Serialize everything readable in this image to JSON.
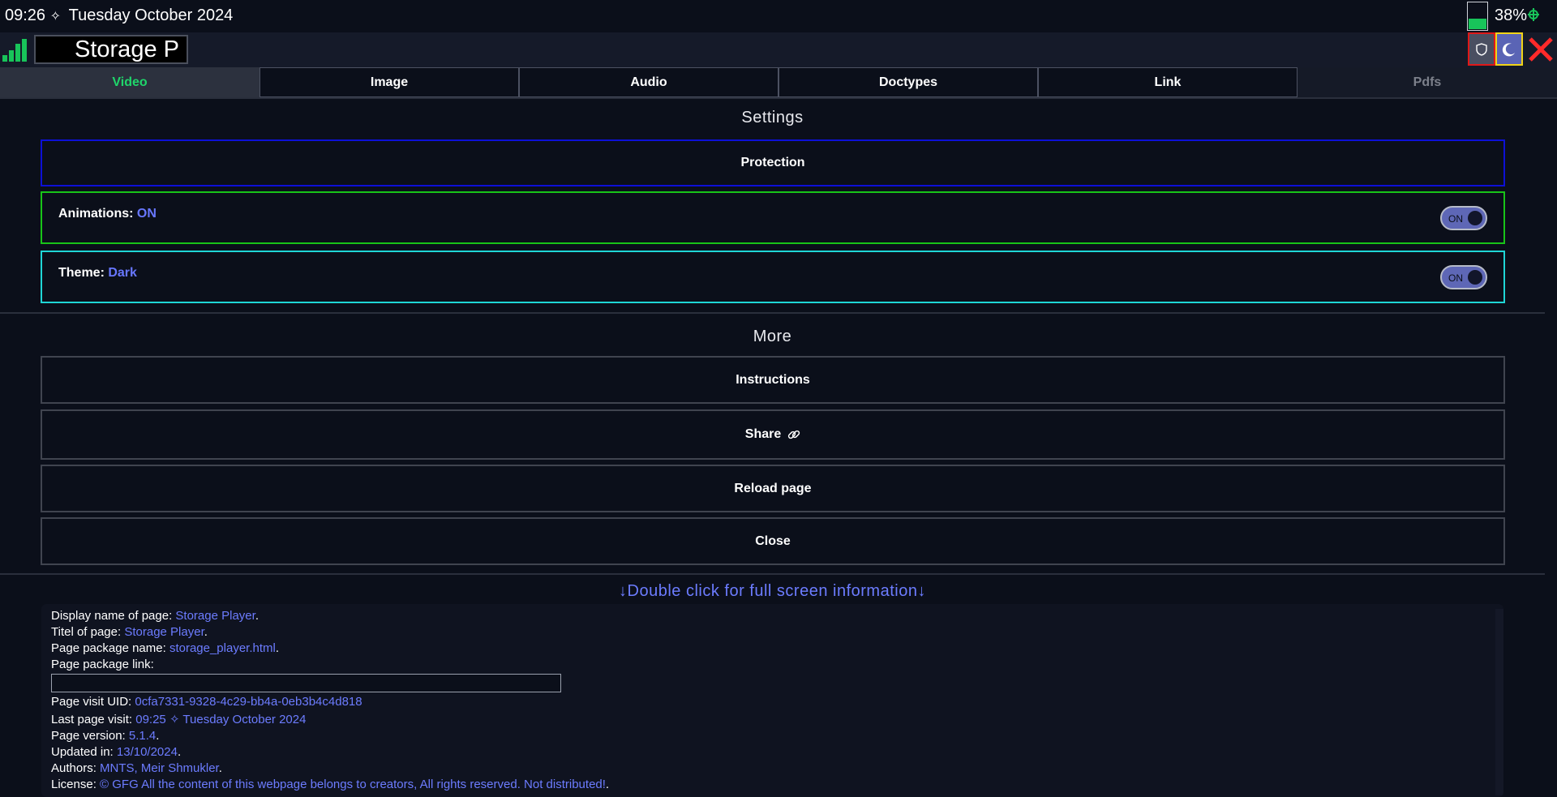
{
  "status_bar": {
    "time": "09:26",
    "separator": "✧",
    "date": "Tuesday October 2024",
    "battery_level": 0.38,
    "battery_percent": "38%",
    "charging_icon": "plug-icon"
  },
  "header": {
    "title": "Storage P",
    "signal_icon": "signal-bars-icon",
    "buttons": {
      "protection_icon": "shield-icon",
      "theme_icon": "moon-icon",
      "close_icon": "close-icon"
    }
  },
  "tabs": [
    {
      "label": "Video",
      "state": "active"
    },
    {
      "label": "Image",
      "state": "normal"
    },
    {
      "label": "Audio",
      "state": "normal"
    },
    {
      "label": "Doctypes",
      "state": "normal"
    },
    {
      "label": "Link",
      "state": "normal"
    },
    {
      "label": "Pdfs",
      "state": "disabled"
    }
  ],
  "settings": {
    "title": "Settings",
    "protection_label": "Protection",
    "animations": {
      "label": "Animations: ",
      "value": "ON",
      "toggle": "ON"
    },
    "theme": {
      "label": "Theme: ",
      "value": "Dark",
      "toggle": "ON"
    }
  },
  "more": {
    "title": "More",
    "instructions_label": "Instructions",
    "share_label": "Share",
    "share_icon": "link-icon",
    "reload_label": "Reload page",
    "close_label": "Close"
  },
  "info": {
    "hint": "↓Double click for full screen information↓",
    "rows": {
      "display_name": {
        "label": "Display name of page: ",
        "value": "Storage Player",
        "end": "."
      },
      "title": {
        "label": "Titel of page: ",
        "value": "Storage Player",
        "end": "."
      },
      "package_name": {
        "label": "Page package name: ",
        "value": "storage_player.html",
        "end": "."
      },
      "package_link": {
        "label": "Page package link:"
      },
      "visit_uid": {
        "label": "Page visit UID: ",
        "value": "0cfa7331-9328-4c29-bb4a-0eb3b4c4d818"
      },
      "last_visit": {
        "label": "Last page visit: ",
        "value": "09:25 ✧ Tuesday October 2024"
      },
      "version": {
        "label": "Page version: ",
        "value": "5.1.4",
        "end": "."
      },
      "updated": {
        "label": "Updated in: ",
        "value": "13/10/2024",
        "end": "."
      },
      "authors": {
        "label": "Authors: ",
        "value": "MNTS, Meir Shmukler",
        "end": "."
      },
      "license": {
        "label": "License: ",
        "value": "© GFG All the content of this webpage belongs to creators, All rights reserved. Not distributed!",
        "end": "."
      }
    }
  },
  "colors": {
    "background": "#0b0f1a",
    "accent_green": "#1fd56a",
    "accent_blue": "#6c7cff",
    "protection_border": "#0d10d6",
    "animations_border": "#18c418",
    "theme_border": "#1fd6d6"
  }
}
